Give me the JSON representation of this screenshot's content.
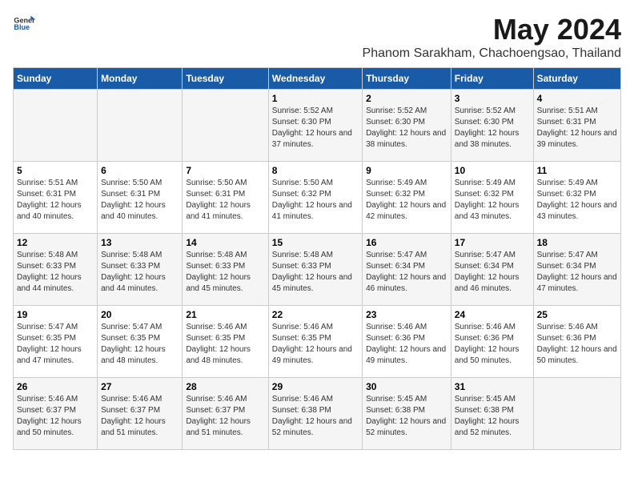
{
  "logo": {
    "general": "General",
    "blue": "Blue"
  },
  "title": "May 2024",
  "subtitle": "Phanom Sarakham, Chachoengsao, Thailand",
  "days_of_week": [
    "Sunday",
    "Monday",
    "Tuesday",
    "Wednesday",
    "Thursday",
    "Friday",
    "Saturday"
  ],
  "weeks": [
    [
      {
        "day": "",
        "info": ""
      },
      {
        "day": "",
        "info": ""
      },
      {
        "day": "",
        "info": ""
      },
      {
        "day": "1",
        "sunrise": "5:52 AM",
        "sunset": "6:30 PM",
        "daylight": "12 hours and 37 minutes."
      },
      {
        "day": "2",
        "sunrise": "5:52 AM",
        "sunset": "6:30 PM",
        "daylight": "12 hours and 38 minutes."
      },
      {
        "day": "3",
        "sunrise": "5:52 AM",
        "sunset": "6:30 PM",
        "daylight": "12 hours and 38 minutes."
      },
      {
        "day": "4",
        "sunrise": "5:51 AM",
        "sunset": "6:31 PM",
        "daylight": "12 hours and 39 minutes."
      }
    ],
    [
      {
        "day": "5",
        "sunrise": "5:51 AM",
        "sunset": "6:31 PM",
        "daylight": "12 hours and 40 minutes."
      },
      {
        "day": "6",
        "sunrise": "5:50 AM",
        "sunset": "6:31 PM",
        "daylight": "12 hours and 40 minutes."
      },
      {
        "day": "7",
        "sunrise": "5:50 AM",
        "sunset": "6:31 PM",
        "daylight": "12 hours and 41 minutes."
      },
      {
        "day": "8",
        "sunrise": "5:50 AM",
        "sunset": "6:32 PM",
        "daylight": "12 hours and 41 minutes."
      },
      {
        "day": "9",
        "sunrise": "5:49 AM",
        "sunset": "6:32 PM",
        "daylight": "12 hours and 42 minutes."
      },
      {
        "day": "10",
        "sunrise": "5:49 AM",
        "sunset": "6:32 PM",
        "daylight": "12 hours and 43 minutes."
      },
      {
        "day": "11",
        "sunrise": "5:49 AM",
        "sunset": "6:32 PM",
        "daylight": "12 hours and 43 minutes."
      }
    ],
    [
      {
        "day": "12",
        "sunrise": "5:48 AM",
        "sunset": "6:33 PM",
        "daylight": "12 hours and 44 minutes."
      },
      {
        "day": "13",
        "sunrise": "5:48 AM",
        "sunset": "6:33 PM",
        "daylight": "12 hours and 44 minutes."
      },
      {
        "day": "14",
        "sunrise": "5:48 AM",
        "sunset": "6:33 PM",
        "daylight": "12 hours and 45 minutes."
      },
      {
        "day": "15",
        "sunrise": "5:48 AM",
        "sunset": "6:33 PM",
        "daylight": "12 hours and 45 minutes."
      },
      {
        "day": "16",
        "sunrise": "5:47 AM",
        "sunset": "6:34 PM",
        "daylight": "12 hours and 46 minutes."
      },
      {
        "day": "17",
        "sunrise": "5:47 AM",
        "sunset": "6:34 PM",
        "daylight": "12 hours and 46 minutes."
      },
      {
        "day": "18",
        "sunrise": "5:47 AM",
        "sunset": "6:34 PM",
        "daylight": "12 hours and 47 minutes."
      }
    ],
    [
      {
        "day": "19",
        "sunrise": "5:47 AM",
        "sunset": "6:35 PM",
        "daylight": "12 hours and 47 minutes."
      },
      {
        "day": "20",
        "sunrise": "5:47 AM",
        "sunset": "6:35 PM",
        "daylight": "12 hours and 48 minutes."
      },
      {
        "day": "21",
        "sunrise": "5:46 AM",
        "sunset": "6:35 PM",
        "daylight": "12 hours and 48 minutes."
      },
      {
        "day": "22",
        "sunrise": "5:46 AM",
        "sunset": "6:35 PM",
        "daylight": "12 hours and 49 minutes."
      },
      {
        "day": "23",
        "sunrise": "5:46 AM",
        "sunset": "6:36 PM",
        "daylight": "12 hours and 49 minutes."
      },
      {
        "day": "24",
        "sunrise": "5:46 AM",
        "sunset": "6:36 PM",
        "daylight": "12 hours and 50 minutes."
      },
      {
        "day": "25",
        "sunrise": "5:46 AM",
        "sunset": "6:36 PM",
        "daylight": "12 hours and 50 minutes."
      }
    ],
    [
      {
        "day": "26",
        "sunrise": "5:46 AM",
        "sunset": "6:37 PM",
        "daylight": "12 hours and 50 minutes."
      },
      {
        "day": "27",
        "sunrise": "5:46 AM",
        "sunset": "6:37 PM",
        "daylight": "12 hours and 51 minutes."
      },
      {
        "day": "28",
        "sunrise": "5:46 AM",
        "sunset": "6:37 PM",
        "daylight": "12 hours and 51 minutes."
      },
      {
        "day": "29",
        "sunrise": "5:46 AM",
        "sunset": "6:38 PM",
        "daylight": "12 hours and 52 minutes."
      },
      {
        "day": "30",
        "sunrise": "5:45 AM",
        "sunset": "6:38 PM",
        "daylight": "12 hours and 52 minutes."
      },
      {
        "day": "31",
        "sunrise": "5:45 AM",
        "sunset": "6:38 PM",
        "daylight": "12 hours and 52 minutes."
      },
      {
        "day": "",
        "info": ""
      }
    ]
  ]
}
